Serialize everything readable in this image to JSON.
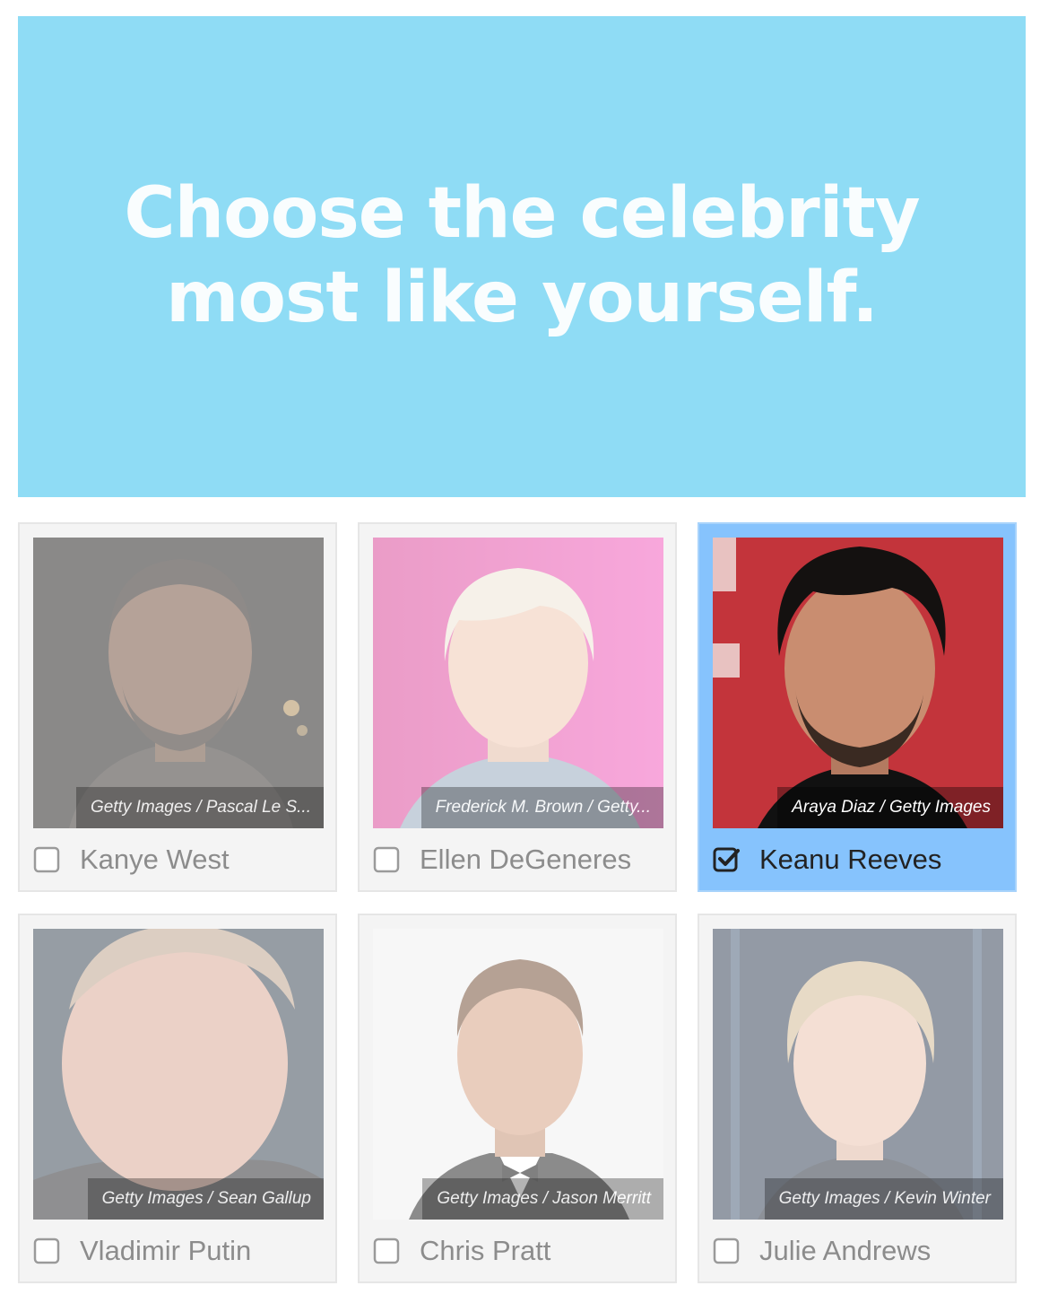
{
  "quiz": {
    "question": "Choose the celebrity most like yourself."
  },
  "colors": {
    "banner_bg": "#8fdcf5",
    "card_bg": "#f4f4f4",
    "card_selected_bg": "#86c3fd",
    "text_muted": "#8c8c8c",
    "text_selected": "#222222"
  },
  "options": [
    {
      "name": "Kanye West",
      "credit": "Getty Images / Pascal Le S...",
      "selected": false,
      "checkbox_icon": "unchecked-box"
    },
    {
      "name": "Ellen DeGeneres",
      "credit": "Frederick M. Brown / Getty...",
      "selected": false,
      "checkbox_icon": "unchecked-box"
    },
    {
      "name": "Keanu Reeves",
      "credit": "Araya Diaz / Getty Images",
      "selected": true,
      "checkbox_icon": "checked-box"
    },
    {
      "name": "Vladimir Putin",
      "credit": "Getty Images / Sean Gallup",
      "selected": false,
      "checkbox_icon": "unchecked-box"
    },
    {
      "name": "Chris Pratt",
      "credit": "Getty Images / Jason Merritt",
      "selected": false,
      "checkbox_icon": "unchecked-box"
    },
    {
      "name": "Julie Andrews",
      "credit": "Getty Images / Kevin Winter",
      "selected": false,
      "checkbox_icon": "unchecked-box"
    }
  ]
}
